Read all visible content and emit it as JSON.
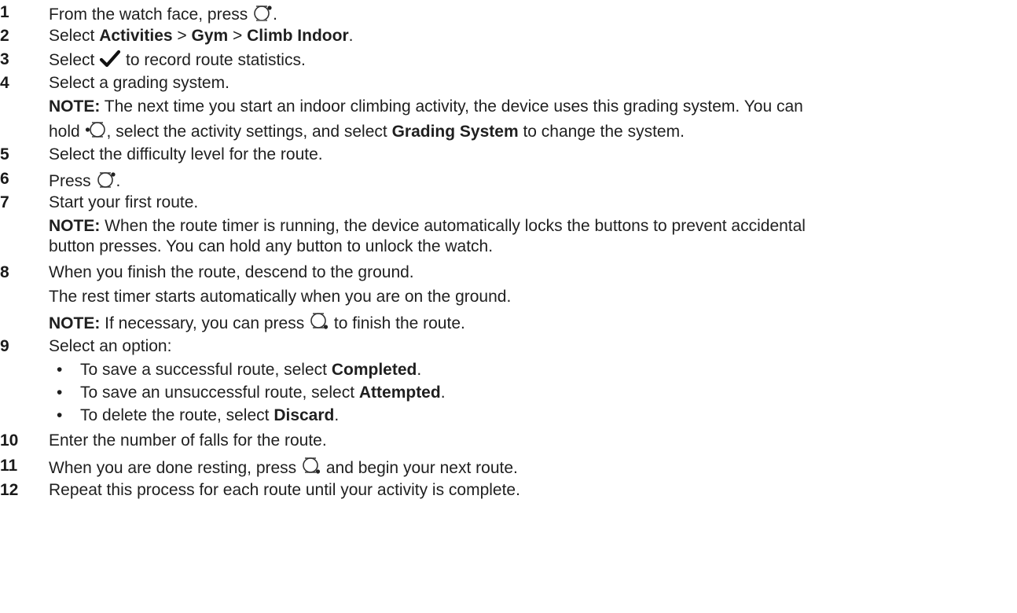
{
  "steps": {
    "s1": {
      "num": "1",
      "a": "From the watch face, press ",
      "icon": "watch-button-upper-right-icon",
      "b": "."
    },
    "s2": {
      "num": "2",
      "a": "Select ",
      "b1": "Activities",
      "sep1": " > ",
      "b2": "Gym",
      "sep2": " > ",
      "b3": "Climb Indoor",
      "end": "."
    },
    "s3": {
      "num": "3",
      "a": "Select ",
      "icon": "checkmark-icon",
      "b": " to record route statistics."
    },
    "s4": {
      "num": "4",
      "text": "Select a grading system.",
      "note_label": "NOTE:",
      "note_l1": " The next time you start an indoor climbing activity, the device uses this grading system. You can",
      "note_l2a": "hold ",
      "note_icon": "watch-button-left-icon",
      "note_l2b": ", select the activity settings, and select ",
      "note_l2_bold": "Grading System",
      "note_l2c": " to change the system."
    },
    "s5": {
      "num": "5",
      "text": "Select the difficulty level for the route."
    },
    "s6": {
      "num": "6",
      "a": "Press ",
      "icon": "watch-button-upper-right-icon",
      "b": "."
    },
    "s7": {
      "num": "7",
      "text": "Start your first route.",
      "note_label": "NOTE:",
      "note_l1": " When the route timer is running, the device automatically locks the buttons to prevent accidental",
      "note_l2": "button presses. You can hold any button to unlock the watch."
    },
    "s8": {
      "num": "8",
      "text": "When you finish the route, descend to the ground.",
      "sub": "The rest timer starts automatically when you are on the ground.",
      "note_label": "NOTE:",
      "note_a": " If necessary, you can press ",
      "note_icon": "watch-button-lower-right-icon",
      "note_b": " to finish the route."
    },
    "s9": {
      "num": "9",
      "text": "Select an option:",
      "bullet_char": "•",
      "o1a": "To save a successful route, select ",
      "o1b": "Completed",
      "o1c": ".",
      "o2a": "To save an unsuccessful route, select ",
      "o2b": "Attempted",
      "o2c": ".",
      "o3a": "To delete the route, select ",
      "o3b": "Discard",
      "o3c": "."
    },
    "s10": {
      "num": "10",
      "text": "Enter the number of falls for the route."
    },
    "s11": {
      "num": "11",
      "a": "When you are done resting, press ",
      "icon": "watch-button-lower-right-icon",
      "b": " and begin your next route."
    },
    "s12": {
      "num": "12",
      "text": "Repeat this process for each route until your activity is complete."
    }
  }
}
